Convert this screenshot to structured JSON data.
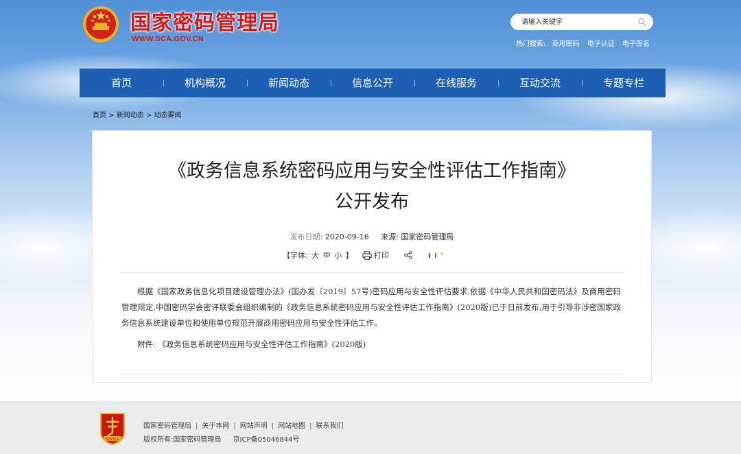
{
  "header": {
    "site_title": "国家密码管理局",
    "site_url": "WWW.SCA.GOV.CN",
    "search": {
      "placeholder": "请输入关键字"
    },
    "hot_search": {
      "label": "热门搜索:",
      "links": [
        "商用密码",
        "电子认证",
        "电子签名"
      ]
    }
  },
  "nav": {
    "items": [
      "首页",
      "机构概况",
      "新闻动态",
      "信息公开",
      "在线服务",
      "互动交流",
      "专题专栏"
    ]
  },
  "breadcrumb": {
    "items": [
      "首页",
      "新闻动态",
      "动态要闻"
    ],
    "separator": ">"
  },
  "article": {
    "title_line1": "《政务信息系统密码应用与安全性评估工作指南》",
    "title_line2": "公开发布",
    "meta": {
      "date_label": "发布日期:",
      "date": "2020-09-16",
      "source_label": "来源:",
      "source": "国家密码管理局"
    },
    "tools": {
      "font_label_open": "【字体:",
      "font_large": "大",
      "font_medium": "中",
      "font_small": "小",
      "font_label_close": "】",
      "print_label": "打印"
    },
    "body": "根据《国家政务信息化项目建设管理办法》(国办发〔2019〕57号)密码应用与安全性评估要求,依据《中华人民共和国密码法》及商用密码管理规定,中国密码学会密评联委会组织编制的《政务信息系统密码应用与安全性评估工作指南》(2020版)已于日前发布,用于引导非涉密国家政务信息系统建设单位和使用单位规范开展商用密码应用与安全性评估工作。",
    "attachment_label": "附件:",
    "attachment_link": "《政务信息系统密码应用与安全性评估工作指南》(2020版)"
  },
  "footer": {
    "links": [
      "国家密码管理局",
      "关于本网",
      "网站声明",
      "网站地图",
      "联系我们"
    ],
    "separator": "|",
    "copyright": "版权所有:国家密码管理局",
    "icp": "京ICP备05046844号",
    "logo_text": "党政机关"
  },
  "colors": {
    "brand_red": "#d01b1b",
    "nav_blue": "#1d5fb3",
    "footer_bg": "#ececec"
  }
}
